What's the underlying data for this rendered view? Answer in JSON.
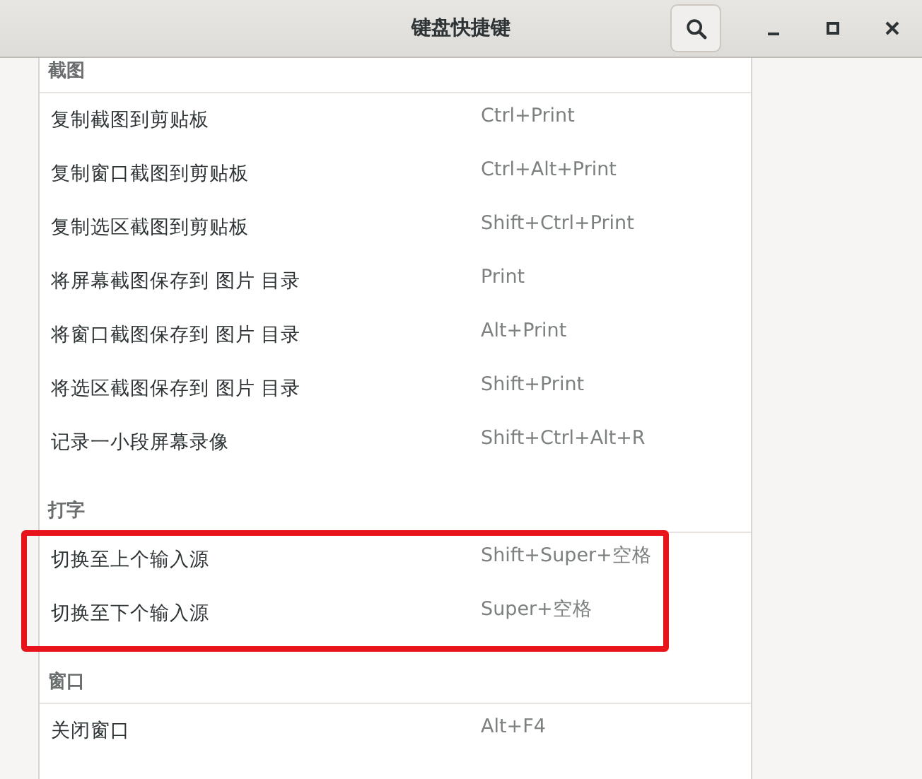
{
  "window": {
    "title": "键盘快捷键"
  },
  "sections": [
    {
      "title": "截图",
      "highlighted": false,
      "shortcuts": [
        {
          "action": "复制截图到剪贴板",
          "keys": "Ctrl+Print"
        },
        {
          "action": "复制窗口截图到剪贴板",
          "keys": "Ctrl+Alt+Print"
        },
        {
          "action": "复制选区截图到剪贴板",
          "keys": "Shift+Ctrl+Print"
        },
        {
          "action": "将屏幕截图保存到 图片 目录",
          "keys": "Print"
        },
        {
          "action": "将窗口截图保存到 图片 目录",
          "keys": "Alt+Print"
        },
        {
          "action": "将选区截图保存到 图片 目录",
          "keys": "Shift+Print"
        },
        {
          "action": "记录一小段屏幕录像",
          "keys": "Shift+Ctrl+Alt+R"
        }
      ]
    },
    {
      "title": "打字",
      "highlighted": true,
      "shortcuts": [
        {
          "action": "切换至上个输入源",
          "keys": "Shift+Super+空格"
        },
        {
          "action": "切换至下个输入源",
          "keys": "Super+空格"
        }
      ]
    },
    {
      "title": "窗口",
      "highlighted": false,
      "shortcuts": [
        {
          "action": "关闭窗口",
          "keys": "Alt+F4"
        }
      ]
    }
  ]
}
